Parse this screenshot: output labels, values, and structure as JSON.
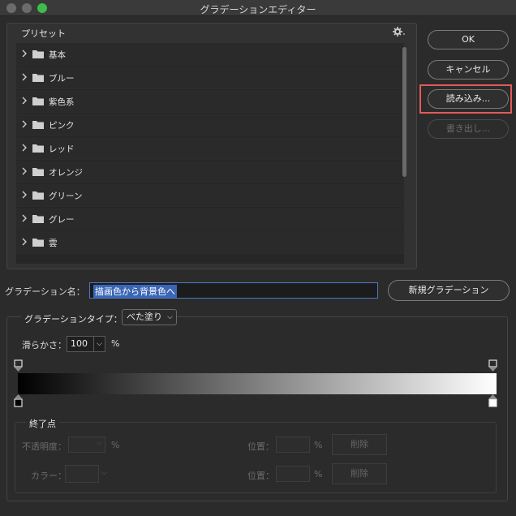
{
  "window": {
    "title": "グラデーションエディター"
  },
  "presets": {
    "label": "プリセット",
    "items": [
      {
        "label": "基本"
      },
      {
        "label": "ブルー"
      },
      {
        "label": "紫色系"
      },
      {
        "label": "ピンク"
      },
      {
        "label": "レッド"
      },
      {
        "label": "オレンジ"
      },
      {
        "label": "グリーン"
      },
      {
        "label": "グレー"
      },
      {
        "label": "雲"
      }
    ]
  },
  "buttons": {
    "ok": "OK",
    "cancel": "キャンセル",
    "load": "読み込み...",
    "save": "書き出し..."
  },
  "name": {
    "label": "グラデーション名：",
    "value": "描画色から背景色へ",
    "new_button": "新規グラデーション"
  },
  "type": {
    "label": "グラデーションタイプ：",
    "selected": "べた塗り"
  },
  "smoothness": {
    "label": "滑らかさ：",
    "value": "100",
    "unit": "%"
  },
  "gradient": {
    "start_color": "#000000",
    "end_color": "#ffffff"
  },
  "stops": {
    "label": "終了点",
    "opacity_label": "不透明度：",
    "opacity_unit": "%",
    "position_label_1": "位置：",
    "position_unit_1": "%",
    "delete_1": "削除",
    "color_label": "カラー：",
    "position_label_2": "位置：",
    "position_unit_2": "%",
    "delete_2": "削除"
  },
  "colors": {
    "highlight": "#e35a5a",
    "selection": "#3a66b6"
  }
}
